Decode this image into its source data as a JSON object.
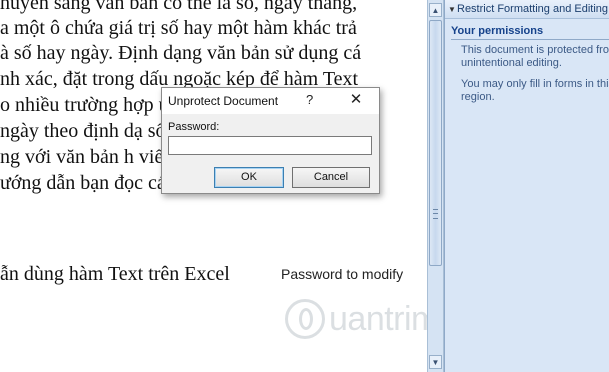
{
  "document": {
    "lines": [
      "huyển sang văn bản có thể là số, ngày tháng,",
      "a một ô chứa giá trị số hay một hàm khác trả",
      "à số hay ngày. Định dạng văn bản sử dụng cá",
      "nh xác, đặt trong dấu ngoặc kép để hàm Text",
      "o nhiều trường hợp                                    ư hiể",
      "ngày theo định dạ                                      số ho",
      "ng với văn bản h                                        viết c",
      "ướng dẫn bạn đọc cách sử dụng hàm Text trê",
      "",
      "ẫn dùng hàm Text trên Excel"
    ],
    "caption": "Password to modify"
  },
  "watermark": {
    "text": "uantrimang"
  },
  "task_pane": {
    "title": "Restrict Formatting and Editing",
    "section_title": "Your permissions",
    "paragraph1": "This document is protected from\nunintentional editing.",
    "paragraph2": "You may only fill in forms in this\nregion."
  },
  "dialog": {
    "title": "Unprotect Document",
    "help": "?",
    "close": "✕",
    "password_label": "Password:",
    "password_value": "",
    "ok_label": "OK",
    "cancel_label": "Cancel"
  },
  "scrollbar": {
    "up_glyph": "▲",
    "down_glyph": "▼"
  }
}
